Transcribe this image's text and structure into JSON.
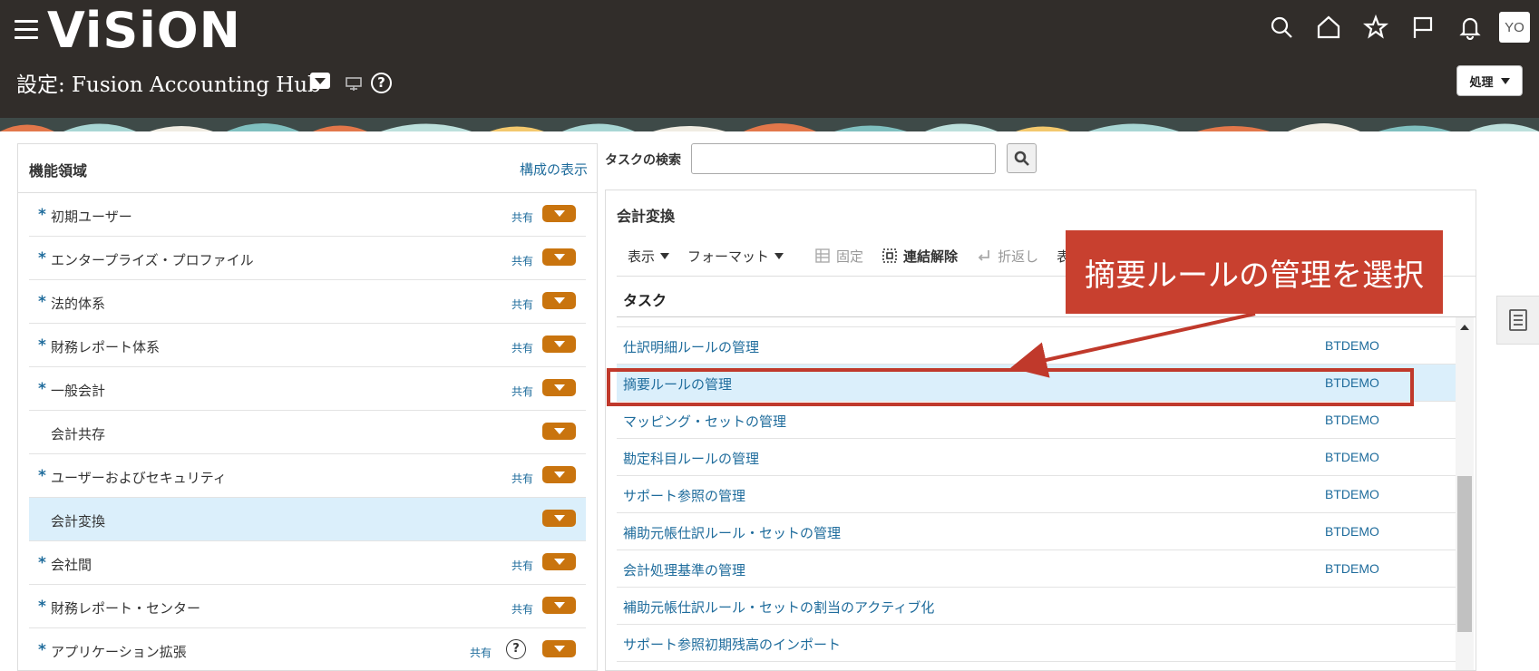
{
  "header": {
    "logo": "ViSiON",
    "page_title": "設定: Fusion Accounting Hub",
    "avatar": "YO",
    "actions_label": "処理",
    "help": "?"
  },
  "left_panel": {
    "title": "機能領域",
    "link": "構成の表示",
    "items": [
      {
        "label": "初期ユーザー",
        "required": "*",
        "shared": "共有"
      },
      {
        "label": "エンタープライズ・プロファイル",
        "required": "*",
        "shared": "共有"
      },
      {
        "label": "法的体系",
        "required": "*",
        "shared": "共有"
      },
      {
        "label": "財務レポート体系",
        "required": "*",
        "shared": "共有"
      },
      {
        "label": "一般会計",
        "required": "*",
        "shared": "共有"
      },
      {
        "label": "会計共存",
        "required": "",
        "shared": ""
      },
      {
        "label": "ユーザーおよびセキュリティ",
        "required": "*",
        "shared": "共有"
      },
      {
        "label": "会計変換",
        "required": "",
        "shared": ""
      },
      {
        "label": "会社間",
        "required": "*",
        "shared": "共有"
      },
      {
        "label": "財務レポート・センター",
        "required": "*",
        "shared": "共有"
      },
      {
        "label": "アプリケーション拡張",
        "required": "*",
        "shared": "共有",
        "help": "?"
      }
    ]
  },
  "search": {
    "label": "タスクの検索",
    "value": "",
    "placeholder": ""
  },
  "right_panel": {
    "title": "会計変換",
    "toolbar": {
      "view": "表示",
      "format": "フォーマット",
      "freeze": "固定",
      "detach": "連結解除",
      "wrap": "折返し",
      "more": "表"
    },
    "column_task": "タスク",
    "tasks": [
      {
        "name": "仕訳明細ルールの管理",
        "owner": "BTDEMO"
      },
      {
        "name": "摘要ルールの管理",
        "owner": "BTDEMO"
      },
      {
        "name": "マッピング・セットの管理",
        "owner": "BTDEMO"
      },
      {
        "name": "勘定科目ルールの管理",
        "owner": "BTDEMO"
      },
      {
        "name": "サポート参照の管理",
        "owner": "BTDEMO"
      },
      {
        "name": "補助元帳仕訳ルール・セットの管理",
        "owner": "BTDEMO"
      },
      {
        "name": "会計処理基準の管理",
        "owner": "BTDEMO"
      },
      {
        "name": "補助元帳仕訳ルール・セットの割当のアクティブ化",
        "owner": ""
      },
      {
        "name": "サポート参照初期残高のインポート",
        "owner": ""
      }
    ]
  },
  "annotation": {
    "callout": "摘要ルールの管理を選択"
  },
  "colors": {
    "header_bg": "#312d2a",
    "link": "#1f6c9c",
    "dropdown": "#c9740e",
    "selected_row": "#dbeffb",
    "callout": "#c8402f"
  }
}
